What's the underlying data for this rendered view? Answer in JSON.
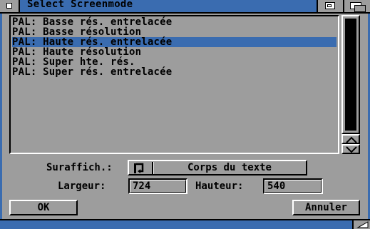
{
  "window": {
    "title": "Select Screenmode"
  },
  "list": {
    "items": [
      "PAL: Basse rés. entrelacée",
      "PAL: Basse résolution",
      "PAL: Haute rés. entrelacée",
      "PAL: Haute résolution",
      "PAL: Super hte. rés.",
      "PAL: Super rés. entrelacée"
    ],
    "selected_index": 2
  },
  "overscan": {
    "label": "Suraffich.:",
    "value": "Corps du texte"
  },
  "width": {
    "label": "Largeur:",
    "value": "724"
  },
  "height": {
    "label": "Hauteur:",
    "value": "540"
  },
  "buttons": {
    "ok": "OK",
    "cancel": "Annuler"
  },
  "colors": {
    "background": "#9d9d9d",
    "accent": "#3a6cb0",
    "shadow": "#000000",
    "highlight": "#ffffff"
  }
}
